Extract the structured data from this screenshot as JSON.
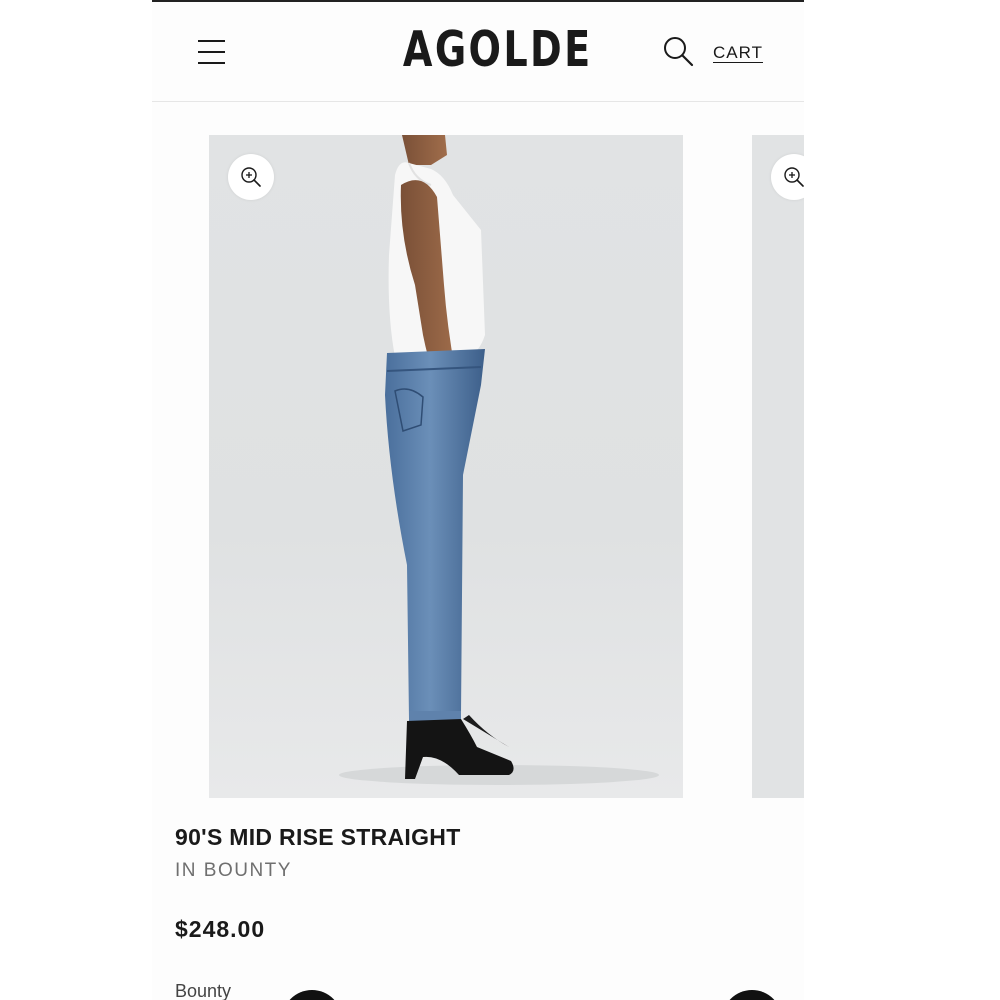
{
  "header": {
    "brand": "AGOLDE",
    "cart_label": "CART"
  },
  "gallery": {
    "zoom_icon": "zoom-in-icon"
  },
  "product": {
    "title": "90'S MID RISE STRAIGHT",
    "subtitle": "IN BOUNTY",
    "price": "$248.00",
    "color_label": "Bounty"
  },
  "colors": {
    "text": "#1a1a1a",
    "muted": "#6f6f6f",
    "photo_bg": "#e1e3e4"
  }
}
